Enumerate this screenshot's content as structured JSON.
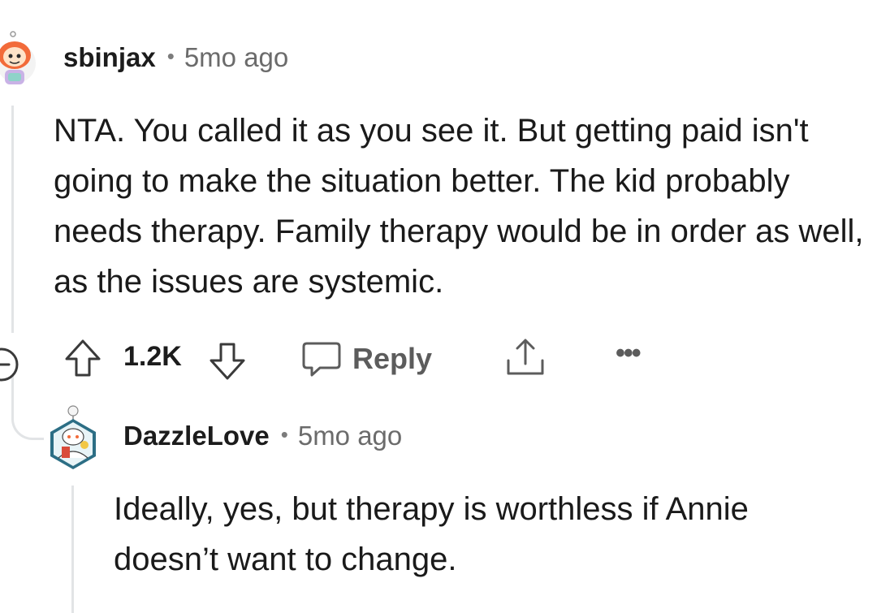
{
  "comment": {
    "username": "sbinjax",
    "separator": "•",
    "time": "5mo ago",
    "text": "NTA. You called it as you see it. But getting paid isn't going to make the situation better. The kid probably needs therapy. Family therapy would be in order as well, as the issues are systemic.",
    "avatar_icon": "snoo-avatar-icon",
    "actions": {
      "collapse_icon": "minus-circle-icon",
      "upvote_icon": "arrow-up-icon",
      "score": "1.2K",
      "downvote_icon": "arrow-down-icon",
      "reply_icon": "speech-bubble-icon",
      "reply_label": "Reply",
      "share_icon": "share-icon",
      "more_label": "•••"
    }
  },
  "reply": {
    "username": "DazzleLove",
    "separator": "•",
    "time": "5mo ago",
    "text": "Ideally, yes, but therapy is worthless if Annie doesn’t want to change.",
    "avatar_icon": "snoo-avatar-icon"
  },
  "colors": {
    "text": "#1c1c1c",
    "meta": "#6b6b6b",
    "action": "#5c5c5c",
    "thread_line": "#e2e4e6",
    "avatar_orange": "#f26b3a",
    "avatar_teal": "#2c6e85"
  }
}
